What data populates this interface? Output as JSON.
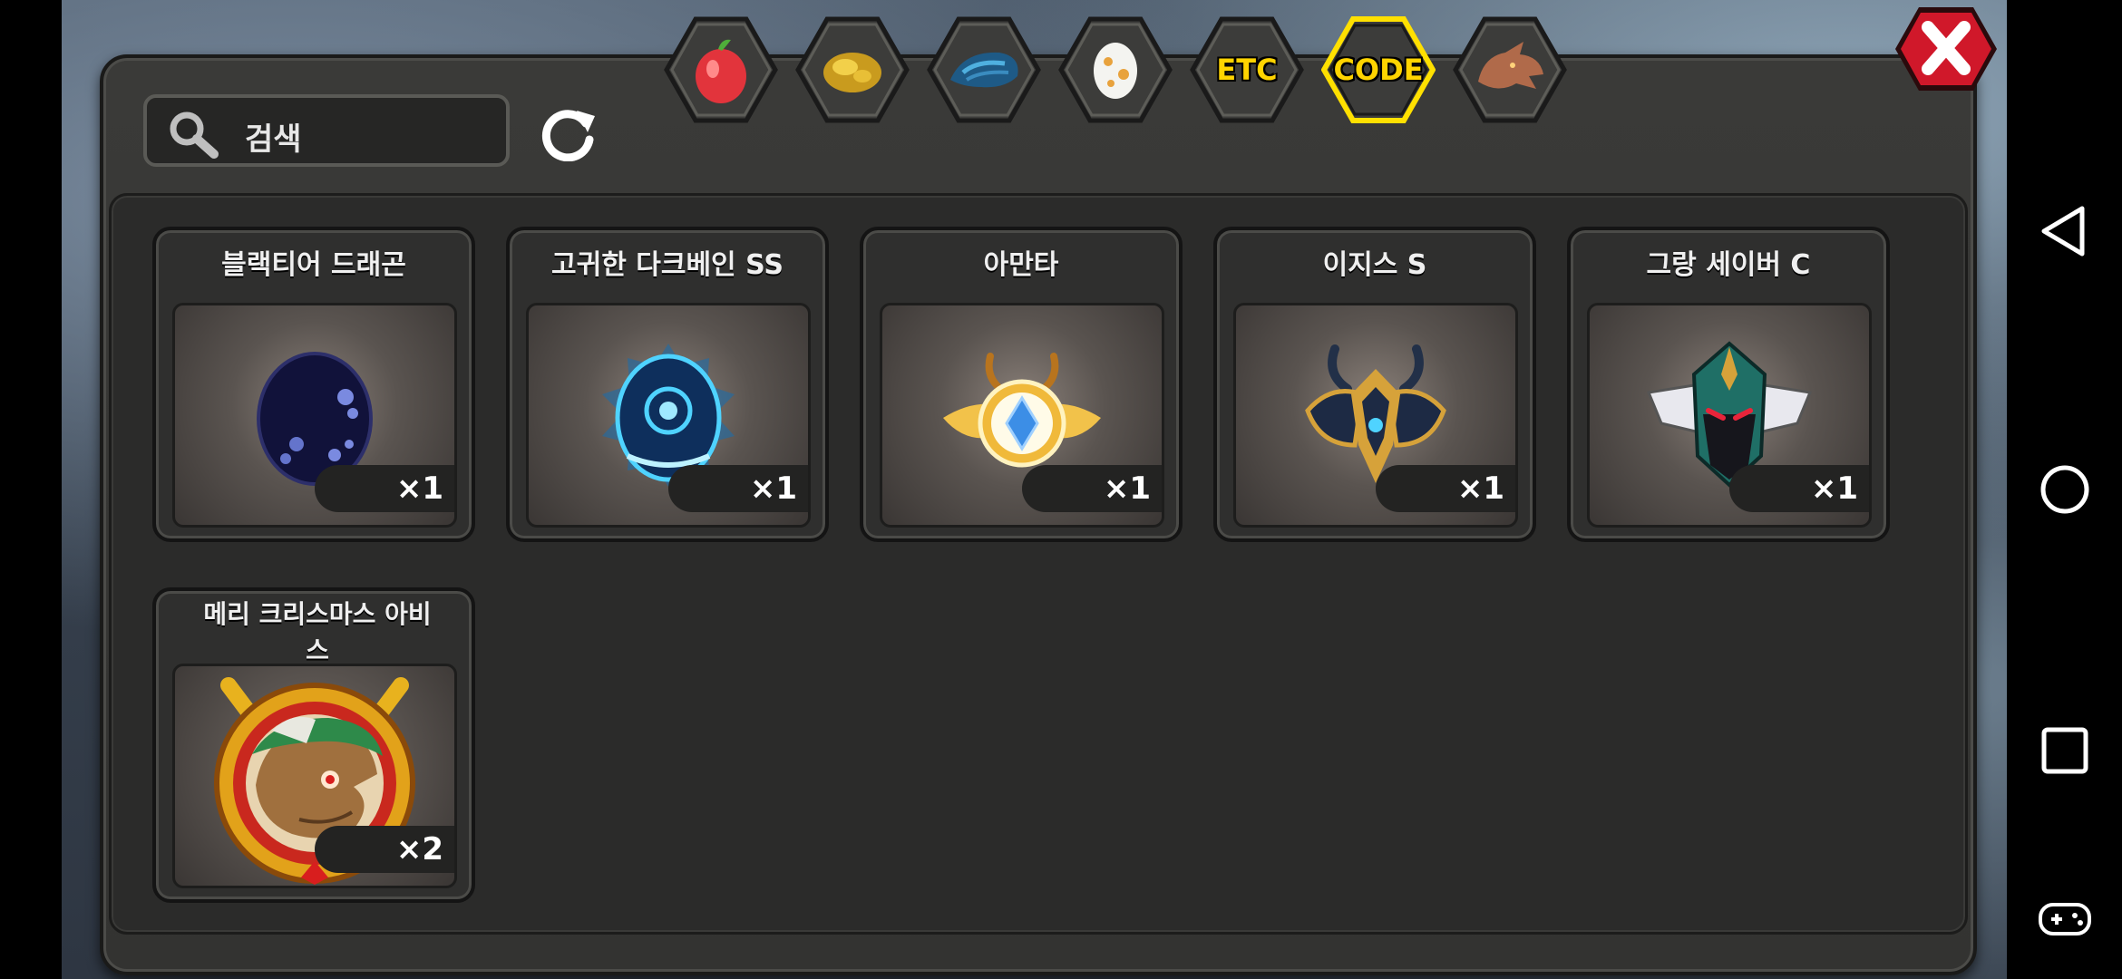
{
  "search": {
    "placeholder": "검색"
  },
  "tabs": [
    {
      "id": "fruit",
      "icon": "fruit-icon",
      "label": ""
    },
    {
      "id": "gold",
      "icon": "gold-nugget-icon",
      "label": ""
    },
    {
      "id": "scale",
      "icon": "dragon-scale-icon",
      "label": ""
    },
    {
      "id": "egg",
      "icon": "egg-icon",
      "label": ""
    },
    {
      "id": "etc",
      "icon": "",
      "label": "ETC"
    },
    {
      "id": "code",
      "icon": "",
      "label": "CODE",
      "selected": true
    },
    {
      "id": "dragon",
      "icon": "dragon-head-icon",
      "label": ""
    }
  ],
  "items": [
    {
      "name": "블랙티어 드래곤",
      "qty": "×1",
      "icon": "dark-egg-icon"
    },
    {
      "name": "고귀한 다크베인 SS",
      "qty": "×1",
      "icon": "ice-egg-icon"
    },
    {
      "name": "아만타",
      "qty": "×1",
      "icon": "golden-crest-icon"
    },
    {
      "name": "이지스 S",
      "qty": "×1",
      "icon": "horned-crest-icon"
    },
    {
      "name": "그랑 세이버 C",
      "qty": "×1",
      "icon": "helmet-crest-icon"
    },
    {
      "name": "메리 크리스마스 아비스",
      "qty": "×2",
      "icon": "dragon-portrait-icon"
    }
  ],
  "colors": {
    "selected_tab_border": "#ffe000",
    "tab_text": "#ffd400",
    "close_red": "#d0182a"
  }
}
